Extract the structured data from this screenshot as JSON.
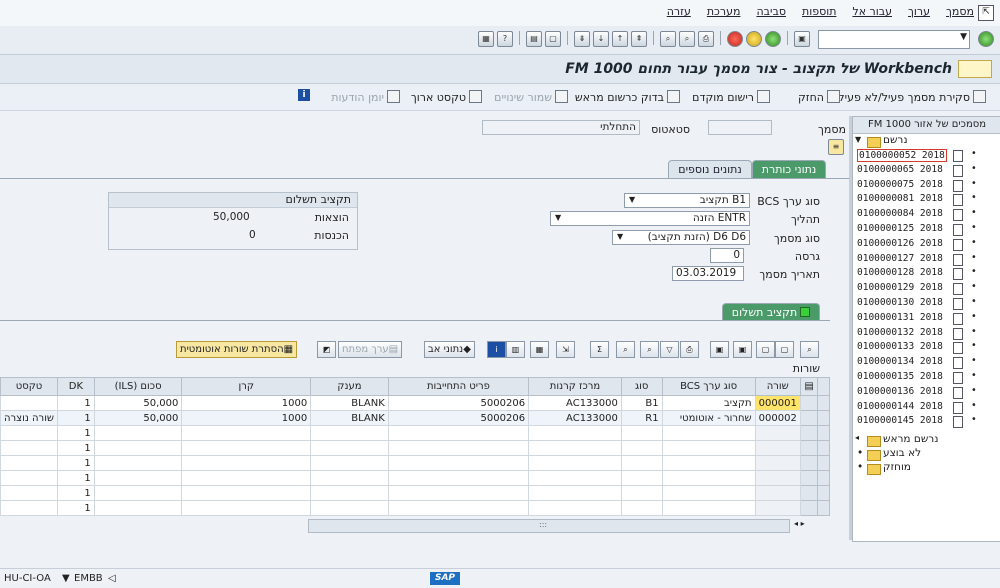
{
  "menu": [
    "מסמך",
    "ערוך",
    "עבור אל",
    "תוספות",
    "סביבה",
    "מערכת",
    "עזרה"
  ],
  "title": "Workbench של תקצוב - צור מסמך עבור תחום FM 1000",
  "app_toolbar": {
    "toggle": "סקירת מסמך פעיל/לא פעיל",
    "hold": "החזק",
    "park": "רישום מוקדם",
    "check": "בדוק כרשום מראש",
    "save_variants": "שמור שינויים",
    "long_text": "טקסט ארוך",
    "log": "יומן הודעות"
  },
  "header": {
    "doc_label": "מסמך",
    "doc_value": "",
    "status_label": "סטאטוס",
    "status_value": "התחלתי"
  },
  "tree": {
    "header": "מסמכים של אזור FM 1000",
    "root": "נרשם",
    "docs": [
      "0100000052 2018",
      "0100000065 2018",
      "0100000075 2018",
      "0100000081 2018",
      "0100000084 2018",
      "0100000125 2018",
      "0100000126 2018",
      "0100000127 2018",
      "0100000128 2018",
      "0100000129 2018",
      "0100000130 2018",
      "0100000131 2018",
      "0100000132 2018",
      "0100000133 2018",
      "0100000134 2018",
      "0100000135 2018",
      "0100000136 2018",
      "0100000144 2018",
      "0100000145 2018"
    ],
    "folders": [
      "נרשם מראש",
      "לא בוצע",
      "מוחזק"
    ]
  },
  "tabs": {
    "header_data": "נתוני כותרת",
    "additional_data": "נתונים נוספים"
  },
  "form": {
    "bcs_label": "סוג ערך BCS",
    "bcs_value": "B1 תקציב",
    "process_label": "תהליך",
    "process_value": "ENTR הזנה",
    "doctype_label": "סוג מסמך",
    "doctype_value": "D6 D6 (הזנת תקציב)",
    "version_label": "גרסה",
    "version_value": "0",
    "date_label": "תאריך מסמך",
    "date_value": "03.03.2019"
  },
  "budget": {
    "title": "תקציב תשלום",
    "expenses_label": "הוצאות",
    "expenses_value": "50,000",
    "revenues_label": "הכנסות",
    "revenues_value": "0"
  },
  "grid": {
    "tab": "תקציב תשלום",
    "title": "שורות",
    "toolbar": {
      "auto_hide": "הסתרת שורות אוטומטית",
      "key_value": "ערך מפתח",
      "user_data": "נתוני אב"
    },
    "columns": [
      "שורה",
      "סוג ערך BCS",
      "סוג",
      "מרכז קרנות",
      "פריט התחייבות",
      "מענק",
      "קרן",
      "סכום (ILS)",
      "DK",
      "טקסט"
    ],
    "rows": [
      [
        "000001",
        "תקציב",
        "B1",
        "AC133000",
        "5000206",
        "BLANK",
        "1000",
        "50,000",
        "1",
        ""
      ],
      [
        "000002",
        "שחרור - אוטומטי",
        "R1",
        "AC133000",
        "5000206",
        "BLANK",
        "1000",
        "50,000",
        "1",
        "שורה נוצרה"
      ],
      [
        "",
        "",
        "",
        "",
        "",
        "",
        "",
        "",
        "1",
        ""
      ],
      [
        "",
        "",
        "",
        "",
        "",
        "",
        "",
        "",
        "1",
        ""
      ],
      [
        "",
        "",
        "",
        "",
        "",
        "",
        "",
        "",
        "1",
        ""
      ],
      [
        "",
        "",
        "",
        "",
        "",
        "",
        "",
        "",
        "1",
        ""
      ],
      [
        "",
        "",
        "",
        "",
        "",
        "",
        "",
        "",
        "1",
        ""
      ],
      [
        "",
        "",
        "",
        "",
        "",
        "",
        "",
        "",
        "1",
        ""
      ]
    ]
  },
  "status": {
    "system": "HU-CI-OA",
    "client": "EMBB",
    "sap": "SAP"
  }
}
